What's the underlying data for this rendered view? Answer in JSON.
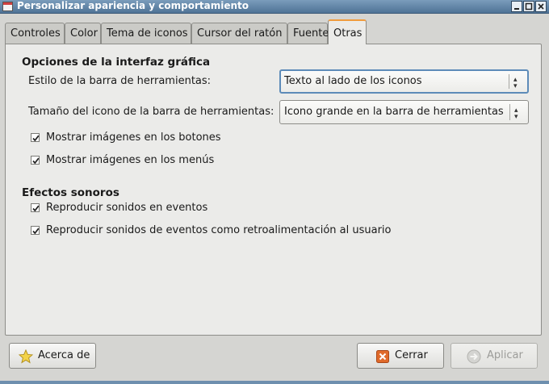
{
  "window": {
    "title": "Personalizar apariencia y comportamiento"
  },
  "tabs": [
    {
      "label": "Controles"
    },
    {
      "label": "Color"
    },
    {
      "label": "Tema de iconos"
    },
    {
      "label": "Cursor del ratón"
    },
    {
      "label": "Fuente"
    },
    {
      "label": "Otras",
      "active": true
    }
  ],
  "gui_options": {
    "title": "Opciones de la interfaz gráfica",
    "toolbar_style_label": "Estilo de la barra de herramientas:",
    "toolbar_style_value": "Texto al lado de los iconos",
    "toolbar_icon_size_label": "Tamaño del icono de la barra de herramientas:",
    "toolbar_icon_size_value": "Icono grande en la barra de herramientas",
    "show_button_images": {
      "label": "Mostrar imágenes en los botones",
      "checked": true
    },
    "show_menu_images": {
      "label": "Mostrar imágenes en los menús",
      "checked": true
    }
  },
  "sound_effects": {
    "title": "Efectos sonoros",
    "play_event_sounds": {
      "label": "Reproducir sonidos en eventos",
      "checked": true
    },
    "play_feedback_sounds": {
      "label": "Reproducir sonidos de eventos como retroalimentación al usuario",
      "checked": true
    }
  },
  "buttons": {
    "about": "Acerca de",
    "close": "Cerrar",
    "apply": "Aplicar"
  },
  "icons": {
    "app": "window-app-icon",
    "about": "star-icon",
    "close": "close-x-icon",
    "apply": "apply-arrow-icon"
  },
  "colors": {
    "titlebar": "#5a7fa3",
    "active_tab_accent": "#f09b3c",
    "close_icon": "#e06a2a",
    "focus_border": "#5d8bb8"
  }
}
